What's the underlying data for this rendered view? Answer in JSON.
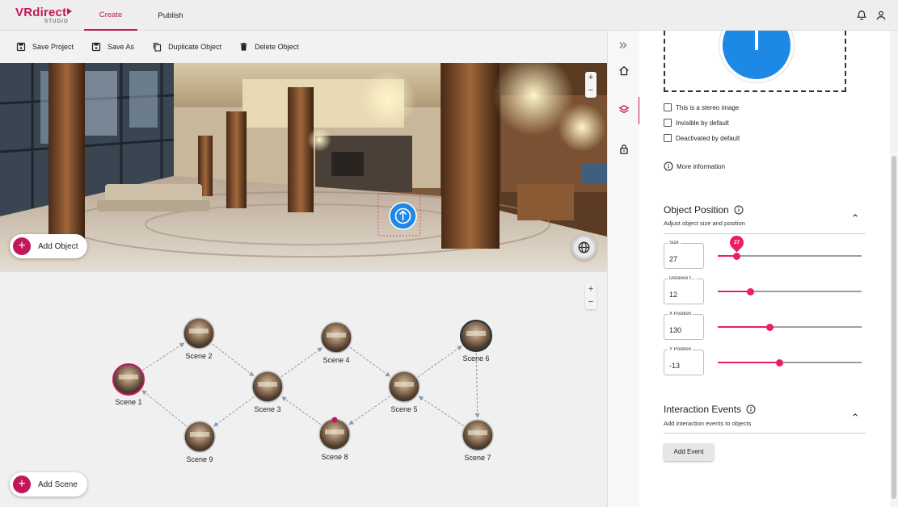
{
  "app": {
    "logo_main": "VRdirect",
    "logo_sub": "STUDIO",
    "tabs": [
      {
        "label": "Create",
        "active": true
      },
      {
        "label": "Publish",
        "active": false
      }
    ],
    "accent_color": "#c2185b"
  },
  "toolbar": {
    "save_project": "Save Project",
    "save_as": "Save As",
    "duplicate_object": "Duplicate Object",
    "delete_object": "Delete Object"
  },
  "viewer": {
    "zoom_in": "+",
    "zoom_out": "−",
    "add_object_label": "Add Object"
  },
  "graph": {
    "zoom_in": "+",
    "zoom_out": "−",
    "add_scene_label": "Add Scene",
    "scenes": [
      {
        "id": "s1",
        "label": "Scene 1",
        "active": true
      },
      {
        "id": "s2",
        "label": "Scene 2"
      },
      {
        "id": "s3",
        "label": "Scene 3"
      },
      {
        "id": "s4",
        "label": "Scene 4"
      },
      {
        "id": "s5",
        "label": "Scene 5"
      },
      {
        "id": "s6",
        "label": "Scene 6",
        "selected": true
      },
      {
        "id": "s7",
        "label": "Scene 7"
      },
      {
        "id": "s8",
        "label": "Scene 8",
        "marker": true
      },
      {
        "id": "s9",
        "label": "Scene 9"
      }
    ],
    "links": [
      [
        "s1",
        "s2"
      ],
      [
        "s2",
        "s3"
      ],
      [
        "s3",
        "s4"
      ],
      [
        "s4",
        "s5"
      ],
      [
        "s5",
        "s6"
      ],
      [
        "s6",
        "s7"
      ],
      [
        "s7",
        "s5"
      ],
      [
        "s5",
        "s8"
      ],
      [
        "s8",
        "s3"
      ],
      [
        "s3",
        "s9"
      ],
      [
        "s9",
        "s1"
      ]
    ]
  },
  "panel": {
    "checkboxes": [
      {
        "label": "This is a stereo image",
        "checked": false
      },
      {
        "label": "Invisible by default",
        "checked": false
      },
      {
        "label": "Deactivated by default",
        "checked": false
      }
    ],
    "more_information": "More information",
    "object_position": {
      "title": "Object Position",
      "subtitle": "Adjust object size and position",
      "fields": [
        {
          "label": "Size",
          "value": "27",
          "fraction": 0.13,
          "badge": "27"
        },
        {
          "label": "Distance t...",
          "value": "12",
          "fraction": 0.23
        },
        {
          "label": "X Position",
          "value": "130",
          "fraction": 0.36
        },
        {
          "label": "Y Position",
          "value": "-13",
          "fraction": 0.43
        }
      ]
    },
    "interaction_events": {
      "title": "Interaction Events",
      "subtitle": "Add interaction events to objects",
      "add_event": "Add Event"
    }
  }
}
